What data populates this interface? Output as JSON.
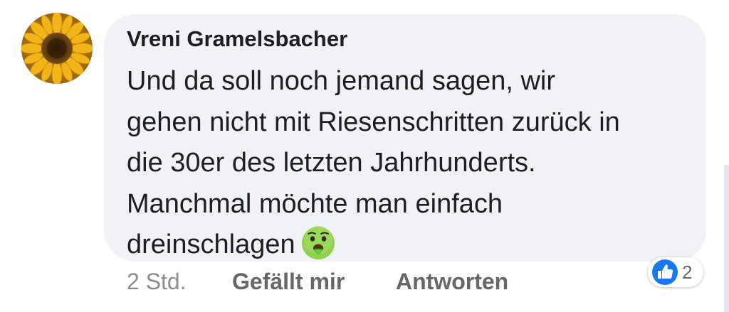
{
  "comment": {
    "author": "Vreni Gramelsbacher",
    "text_lines": [
      "Und da soll noch jemand sagen, wir",
      "gehen nicht mit Riesenschritten zurück in",
      "die 30er des letzten Jahrhunderts.",
      "Manchmal möchte man einfach",
      "dreinschlagen"
    ],
    "emoji": "face-vomiting-emoji"
  },
  "meta": {
    "timestamp": "2 Std.",
    "like_label": "Gefällt mir",
    "reply_label": "Antworten"
  },
  "reactions": {
    "icon": "thumbs-up-icon",
    "count": "2"
  },
  "colors": {
    "bubble": "#f0f2f5",
    "text": "#1c1e21",
    "secondary": "#65676b",
    "like_blue": "#1877f2"
  }
}
